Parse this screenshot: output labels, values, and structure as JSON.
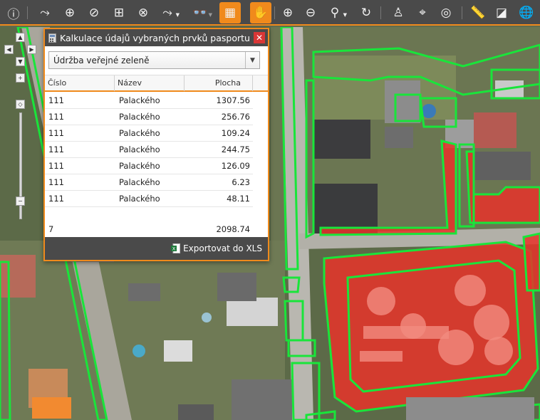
{
  "toolbar": {
    "buttons": [
      {
        "name": "info-icon",
        "glyph": "ⓘ"
      },
      {
        "name": "route-icon",
        "glyph": "⤳"
      },
      {
        "name": "add-point-icon",
        "glyph": "⊕"
      },
      {
        "name": "add-line-icon",
        "glyph": "⊘"
      },
      {
        "name": "add-polygon-icon",
        "glyph": "⊞"
      },
      {
        "name": "delete-feature-icon",
        "glyph": "⊗"
      },
      {
        "name": "routing-tools-icon",
        "glyph": "⤳"
      },
      {
        "name": "binoculars-icon",
        "glyph": "👓"
      },
      {
        "name": "calculator-icon",
        "glyph": "▦"
      },
      {
        "name": "pan-hand-icon",
        "glyph": "✋"
      },
      {
        "name": "zoom-in-icon",
        "glyph": "⊕"
      },
      {
        "name": "zoom-out-icon",
        "glyph": "⊖"
      },
      {
        "name": "search-icon",
        "glyph": "⚲"
      },
      {
        "name": "refresh-icon",
        "glyph": "↻"
      },
      {
        "name": "street-view-icon",
        "glyph": "♙"
      },
      {
        "name": "location-pin-icon",
        "glyph": "⌖"
      },
      {
        "name": "gps-target-icon",
        "glyph": "◎"
      },
      {
        "name": "ruler-icon",
        "glyph": "📏"
      },
      {
        "name": "area-measure-icon",
        "glyph": "◪"
      },
      {
        "name": "globe-settings-icon",
        "glyph": "🌐"
      }
    ]
  },
  "panel": {
    "title": "Kalkulace údajů vybraných prvků pasportu",
    "close_glyph": "✕",
    "select_value": "Údržba veřejné zeleně",
    "columns": {
      "cislo": "Číslo",
      "nazev": "Název",
      "plocha": "Plocha"
    },
    "rows": [
      {
        "cislo": "111",
        "nazev": "Palackého",
        "plocha": "1307.56"
      },
      {
        "cislo": "111",
        "nazev": "Palackého",
        "plocha": "256.76"
      },
      {
        "cislo": "111",
        "nazev": "Palackého",
        "plocha": "109.24"
      },
      {
        "cislo": "111",
        "nazev": "Palackého",
        "plocha": "244.75"
      },
      {
        "cislo": "111",
        "nazev": "Palackého",
        "plocha": "126.09"
      },
      {
        "cislo": "111",
        "nazev": "Palackého",
        "plocha": "6.23"
      },
      {
        "cislo": "111",
        "nazev": "Palackého",
        "plocha": "48.11"
      }
    ],
    "summary": {
      "count": "7",
      "total": "2098.74"
    },
    "export_label": "Exportovat do XLS"
  },
  "colors": {
    "accent": "#f08a1c",
    "toolbar_bg": "#4a4a4a",
    "selected_green": "#19e53a",
    "selected_red": "#e8322a"
  }
}
